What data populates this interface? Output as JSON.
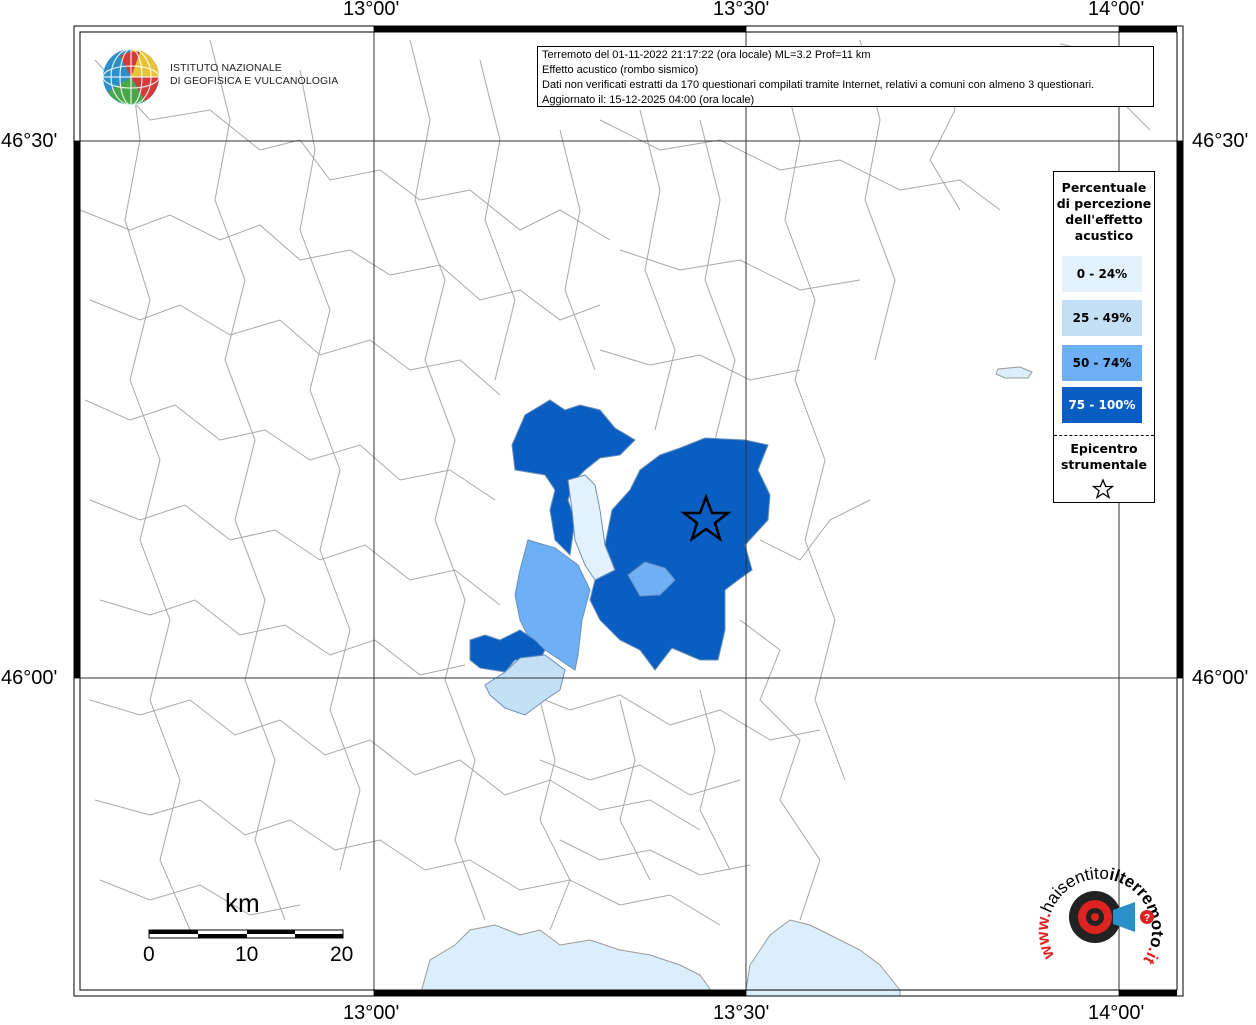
{
  "header": {
    "line1": "Terremoto del 01-11-2022 21:17:22 (ora locale) ML=3.2 Prof=11 km",
    "line2": "Effetto acustico (rombo sismico)",
    "line3": "Dati non verificati estratti da 170 questionari compilati tramite Internet, relativi a comuni con almeno 3 questionari.",
    "line4": "Aggiornato il: 15-12-2025 04:00 (ora locale)"
  },
  "logo": {
    "line1": "ISTITUTO NAZIONALE",
    "line2": "DI GEOFISICA E VULCANOLOGIA"
  },
  "axes": {
    "top": [
      "13°00'",
      "13°30'",
      "14°00'"
    ],
    "bottom": [
      "13°00'",
      "13°30'",
      "14°00'"
    ],
    "left": [
      "46°30'",
      "46°00'"
    ],
    "right": [
      "46°30'",
      "46°00'"
    ]
  },
  "legend": {
    "title_lines": [
      "Percentuale",
      "di percezione",
      "dell'effetto",
      "acustico"
    ],
    "classes": [
      {
        "label": "0 - 24%",
        "color": "#e3f1fc"
      },
      {
        "label": "25 - 49%",
        "color": "#c4e0f7"
      },
      {
        "label": "50 - 74%",
        "color": "#6eb0f5"
      },
      {
        "label": "75 - 100%",
        "color": "#0a5ec2"
      }
    ],
    "epicenter_lines": [
      "Epicentro",
      "strumentale"
    ]
  },
  "scale_bar": {
    "unit": "km",
    "ticks": [
      "0",
      "10",
      "20"
    ]
  },
  "watermark": {
    "text_parts": [
      "www.",
      "haisentito",
      "ilterremoto",
      ".it"
    ]
  },
  "colors": {
    "sea": "#dbeefb",
    "border": "#a8a8a8",
    "grid": "#333333"
  }
}
